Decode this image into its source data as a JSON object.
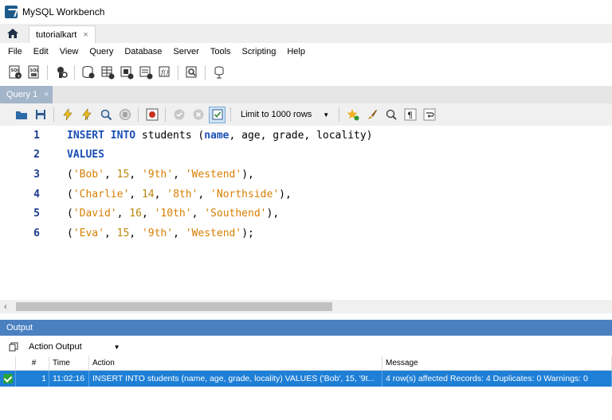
{
  "window": {
    "title": "MySQL Workbench"
  },
  "tabs": {
    "connection": "tutorialkart",
    "close": "×"
  },
  "menu": [
    "File",
    "Edit",
    "View",
    "Query",
    "Database",
    "Server",
    "Tools",
    "Scripting",
    "Help"
  ],
  "query_tab": {
    "label": "Query 1",
    "close": "×"
  },
  "sql_toolbar": {
    "limit_label": "Limit to 1000 rows"
  },
  "editor": {
    "lines": [
      {
        "n": "1",
        "html": "<span class=\"kw\">INSERT INTO</span> students (<span class=\"kw\">name</span>, age, grade, locality)"
      },
      {
        "n": "2",
        "html": "<span class=\"kw\">VALUES</span>"
      },
      {
        "n": "3",
        "html": "(<span class=\"str\">'Bob'</span>, <span class=\"num\">15</span>, <span class=\"str\">'9th'</span>, <span class=\"str\">'Westend'</span>),"
      },
      {
        "n": "4",
        "html": "(<span class=\"str\">'Charlie'</span>, <span class=\"num\">14</span>, <span class=\"str\">'8th'</span>, <span class=\"str\">'Northside'</span>),"
      },
      {
        "n": "5",
        "html": "(<span class=\"str\">'David'</span>, <span class=\"num\">16</span>, <span class=\"str\">'10th'</span>, <span class=\"str\">'Southend'</span>),"
      },
      {
        "n": "6",
        "html": "(<span class=\"str\">'Eva'</span>, <span class=\"num\">15</span>, <span class=\"str\">'9th'</span>, <span class=\"str\">'Westend'</span>);"
      }
    ]
  },
  "output": {
    "header": "Output",
    "selector": "Action Output",
    "columns": [
      "#",
      "Time",
      "Action",
      "Message"
    ],
    "rows": [
      {
        "num": "1",
        "time": "11:02:16",
        "action": "INSERT INTO students (name, age, grade, locality) VALUES  ('Bob', 15, '9t...",
        "message": "4 row(s) affected Records: 4  Duplicates: 0  Warnings: 0"
      }
    ]
  },
  "colors": {
    "keyword": "#1a4fb5",
    "string": "#d77f00",
    "output_header": "#4a80c0",
    "selected_row": "#1e7fd6",
    "success": "#2aa33a"
  }
}
